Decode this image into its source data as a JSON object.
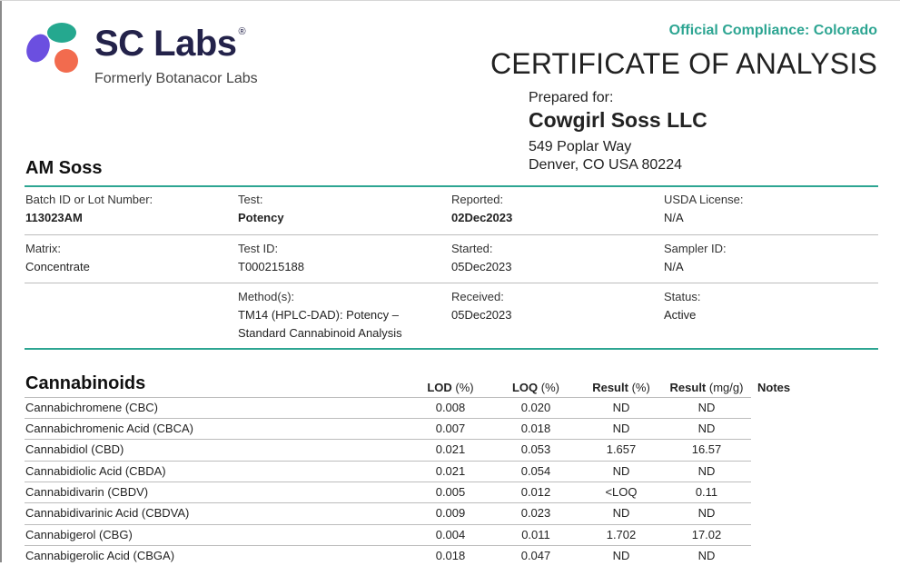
{
  "header": {
    "logo": {
      "name": "SC Labs",
      "registered": "®",
      "subtitle": "Formerly Botanacor Labs"
    },
    "compliance": "Official Compliance: Colorado",
    "title": "CERTIFICATE OF ANALYSIS",
    "prepared_label": "Prepared for:",
    "client_name": "Cowgirl Soss LLC",
    "address_line1": "549 Poplar Way",
    "address_line2": "Denver, CO USA 80224"
  },
  "sample_name": "AM Soss",
  "info": {
    "batch": {
      "label": "Batch ID or Lot Number:",
      "value": "113023AM"
    },
    "test": {
      "label": "Test:",
      "value": "Potency"
    },
    "reported": {
      "label": "Reported:",
      "value": "02Dec2023"
    },
    "usda": {
      "label": "USDA License:",
      "value": "N/A"
    },
    "matrix": {
      "label": "Matrix:",
      "value": "Concentrate"
    },
    "test_id": {
      "label": "Test ID:",
      "value": "T000215188"
    },
    "started": {
      "label": "Started:",
      "value": "05Dec2023"
    },
    "sampler": {
      "label": "Sampler ID:",
      "value": "N/A"
    },
    "methods": {
      "label": "Method(s):",
      "line1": "TM14 (HPLC-DAD): Potency –",
      "line2": "Standard Cannabinoid Analysis"
    },
    "received": {
      "label": "Received:",
      "value": "05Dec2023"
    },
    "status": {
      "label": "Status:",
      "value": "Active"
    }
  },
  "cannabinoids": {
    "title": "Cannabinoids",
    "headers": {
      "lod": "LOD",
      "lod_unit": "(%)",
      "loq": "LOQ",
      "loq_unit": "(%)",
      "result_pct": "Result",
      "result_pct_unit": "(%)",
      "result_mg": "Result",
      "result_mg_unit": "(mg/g)",
      "notes": "Notes"
    },
    "rows": [
      {
        "name": "Cannabichromene (CBC)",
        "lod": "0.008",
        "loq": "0.020",
        "pct": "ND",
        "mg": "ND"
      },
      {
        "name": "Cannabichromenic Acid (CBCA)",
        "lod": "0.007",
        "loq": "0.018",
        "pct": "ND",
        "mg": "ND"
      },
      {
        "name": "Cannabidiol (CBD)",
        "lod": "0.021",
        "loq": "0.053",
        "pct": "1.657",
        "mg": "16.57"
      },
      {
        "name": "Cannabidiolic Acid (CBDA)",
        "lod": "0.021",
        "loq": "0.054",
        "pct": "ND",
        "mg": "ND"
      },
      {
        "name": "Cannabidivarin (CBDV)",
        "lod": "0.005",
        "loq": "0.012",
        "pct": "<LOQ",
        "mg": "0.11"
      },
      {
        "name": "Cannabidivarinic Acid (CBDVA)",
        "lod": "0.009",
        "loq": "0.023",
        "pct": "ND",
        "mg": "ND"
      },
      {
        "name": "Cannabigerol (CBG)",
        "lod": "0.004",
        "loq": "0.011",
        "pct": "1.702",
        "mg": "17.02"
      },
      {
        "name": "Cannabigerolic Acid (CBGA)",
        "lod": "0.018",
        "loq": "0.047",
        "pct": "ND",
        "mg": "ND"
      }
    ]
  },
  "colors": {
    "teal": "#2da592",
    "navy": "#23224a",
    "logo_purple": "#6b4fe0",
    "logo_orange": "#f26b4e",
    "logo_green": "#25a88f"
  }
}
